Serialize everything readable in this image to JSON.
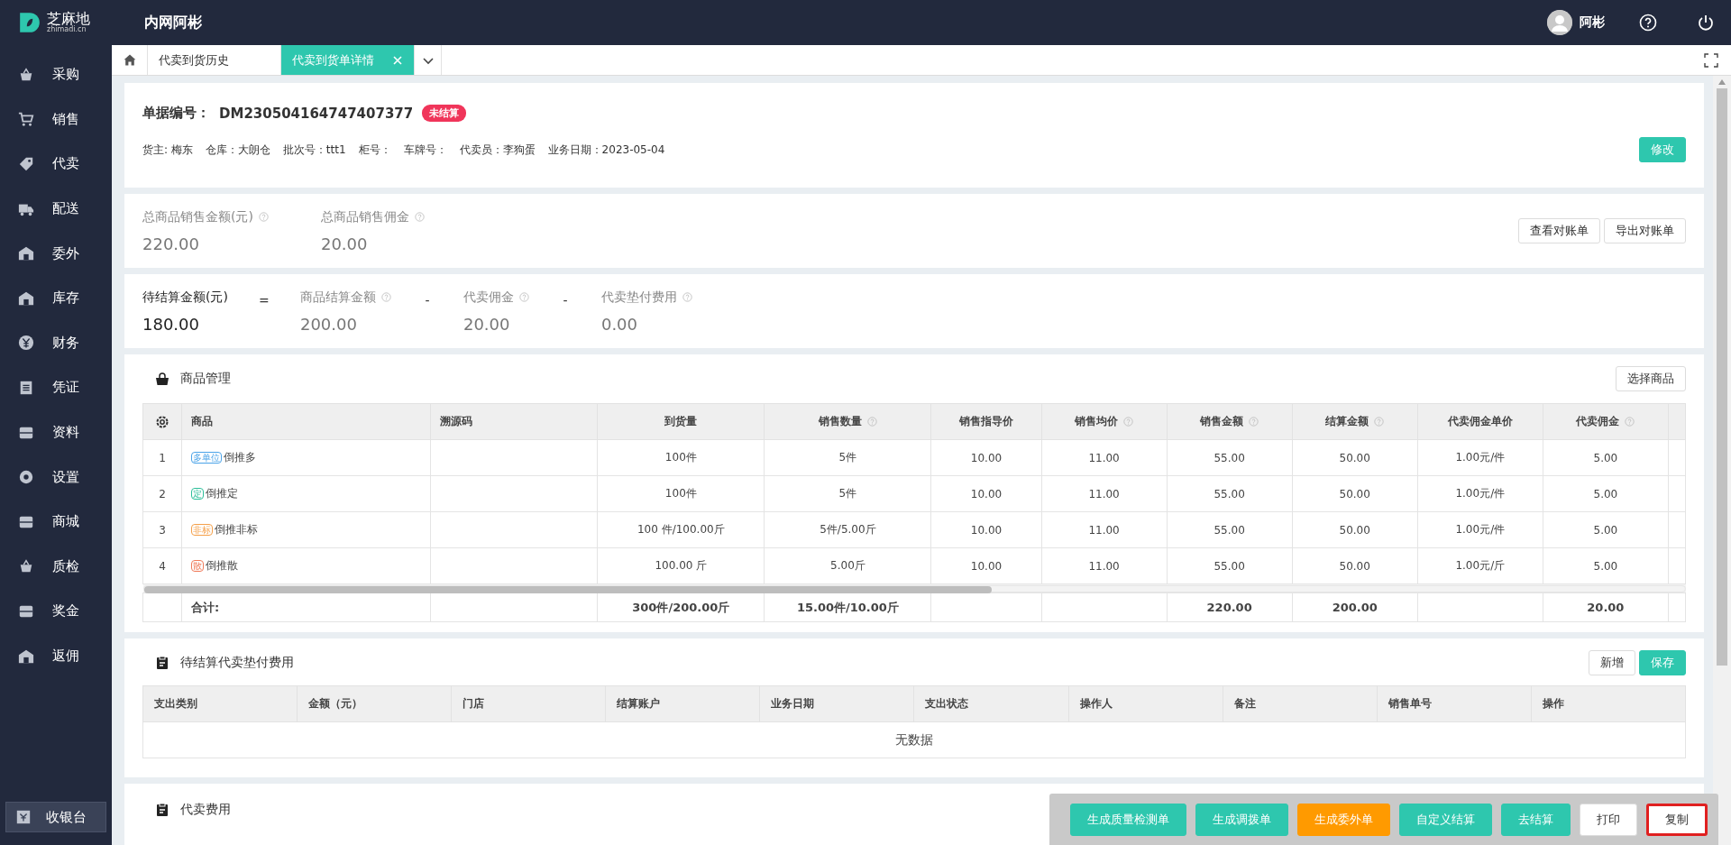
{
  "header": {
    "logo_text": "芝麻地",
    "logo_sub": "zhimadi.cn",
    "title": "内网阿彬",
    "user": "阿彬"
  },
  "sidebar": {
    "items": [
      {
        "label": "采购"
      },
      {
        "label": "销售"
      },
      {
        "label": "代卖"
      },
      {
        "label": "配送"
      },
      {
        "label": "委外"
      },
      {
        "label": "库存"
      },
      {
        "label": "财务"
      },
      {
        "label": "凭证"
      },
      {
        "label": "资料"
      },
      {
        "label": "设置"
      },
      {
        "label": "商城"
      },
      {
        "label": "质检"
      },
      {
        "label": "奖金"
      },
      {
        "label": "返佣"
      }
    ],
    "footer": "收银台"
  },
  "tabs": [
    {
      "label": "代卖到货历史",
      "selected": false,
      "closable": false
    },
    {
      "label": "代卖到货单详情",
      "selected": true,
      "closable": true
    }
  ],
  "document": {
    "number_label": "单据编号：",
    "number": "DM230504164747407377",
    "status": "未结算",
    "fields": [
      "货主: 梅东",
      "仓库：大朗仓",
      "批次号：ttt1",
      "柜号：",
      "车牌号：",
      "代卖员：李狗蛋",
      "业务日期：2023-05-04"
    ],
    "edit_button": "修改"
  },
  "sales_summary": {
    "metrics": [
      {
        "label": "总商品销售金额(元)",
        "value": "220.00",
        "help": true
      },
      {
        "label": "总商品销售佣金",
        "value": "20.00",
        "help": true
      }
    ],
    "buttons": [
      "查看对账单",
      "导出对账单"
    ]
  },
  "settlement_summary": {
    "items": [
      {
        "kind": "result",
        "label": "待结算金额(元)",
        "value": "180.00",
        "help": false
      },
      {
        "kind": "operator",
        "text": "="
      },
      {
        "kind": "term",
        "label": "商品结算金额",
        "value": "200.00",
        "help": true
      },
      {
        "kind": "operator",
        "text": "-"
      },
      {
        "kind": "term",
        "label": "代卖佣金",
        "value": "20.00",
        "help": true
      },
      {
        "kind": "operator",
        "text": "-"
      },
      {
        "kind": "term",
        "label": "代卖垫付费用",
        "value": "0.00",
        "help": true
      }
    ]
  },
  "goods": {
    "title": "商品管理",
    "button": "选择商品",
    "columns": [
      {
        "label": "商品",
        "help": false
      },
      {
        "label": "溯源码",
        "help": false
      },
      {
        "label": "到货量",
        "help": false,
        "total": "300件/200.00斤"
      },
      {
        "label": "销售数量",
        "help": true,
        "total": "15.00件/10.00斤"
      },
      {
        "label": "销售指导价",
        "help": false
      },
      {
        "label": "销售均价",
        "help": true
      },
      {
        "label": "销售金额",
        "help": true,
        "total": "220.00"
      },
      {
        "label": "结算金额",
        "help": true,
        "total": "200.00"
      },
      {
        "label": "代卖佣金单价",
        "help": false
      },
      {
        "label": "代卖佣金",
        "help": true,
        "total": "20.00"
      }
    ],
    "rows": [
      {
        "no": "1",
        "tag": {
          "text": "多单位",
          "color": "#4aa3e8"
        },
        "name": "倒推多",
        "values": [
          "100件",
          "5件",
          "10.00",
          "11.00",
          "55.00",
          "50.00",
          "1.00元/件",
          "5.00"
        ]
      },
      {
        "no": "2",
        "tag": {
          "text": "定",
          "color": "#2ebf9a"
        },
        "name": "倒推定",
        "values": [
          "100件",
          "5件",
          "10.00",
          "11.00",
          "55.00",
          "50.00",
          "1.00元/件",
          "5.00"
        ]
      },
      {
        "no": "3",
        "tag": {
          "text": "非标",
          "color": "#f5a04a"
        },
        "name": "倒推非标",
        "values": [
          "100 件/100.00斤",
          "5件/5.00斤",
          "10.00",
          "11.00",
          "55.00",
          "50.00",
          "1.00元/件",
          "5.00"
        ]
      },
      {
        "no": "4",
        "tag": {
          "text": "散",
          "color": "#f07b5a"
        },
        "name": "倒推散",
        "values": [
          "100.00 斤",
          "5.00斤",
          "10.00",
          "11.00",
          "55.00",
          "50.00",
          "1.00元/斤",
          "5.00"
        ]
      }
    ],
    "totals_label": "合计:"
  },
  "advance_fees": {
    "title": "待结算代卖垫付费用",
    "buttons": [
      {
        "label": "新增",
        "kind": "default"
      },
      {
        "label": "保存",
        "kind": "primary"
      }
    ],
    "columns": [
      "支出类别",
      "金额（元）",
      "门店",
      "结算账户",
      "业务日期",
      "支出状态",
      "操作人",
      "备注",
      "销售单号",
      "操作"
    ],
    "empty_text": "无数据"
  },
  "consignment_fees": {
    "title": "代卖费用"
  },
  "action_bar": {
    "buttons": [
      {
        "label": "生成质量检测单",
        "kind": "primary",
        "highlighted": false
      },
      {
        "label": "生成调拨单",
        "kind": "primary",
        "highlighted": false
      },
      {
        "label": "生成委外单",
        "kind": "warning",
        "highlighted": false
      },
      {
        "label": "自定义结算",
        "kind": "primary",
        "highlighted": false
      },
      {
        "label": "去结算",
        "kind": "primary",
        "highlighted": false
      },
      {
        "label": "打印",
        "kind": "default",
        "highlighted": false
      },
      {
        "label": "复制",
        "kind": "default",
        "highlighted": true
      }
    ]
  }
}
